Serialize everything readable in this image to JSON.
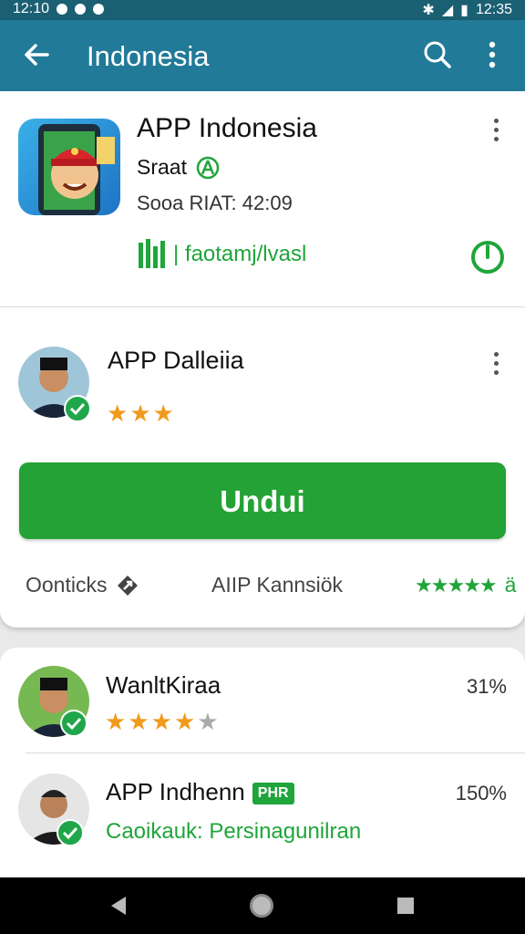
{
  "status_bar": {
    "time_left": "12:10",
    "time_right": "12:35"
  },
  "app_bar": {
    "title": "Indonesia"
  },
  "app": {
    "name": "APP Indonesia",
    "subtitle": "Sraat",
    "meta": "Sooa RIAT: 42:09",
    "link_text": "| faotamj/lvasl"
  },
  "developer": {
    "name": "APP Dalleiia",
    "rating_stars": 3
  },
  "install_button": {
    "label": "Undui"
  },
  "footer": {
    "left_label": "Oonticks",
    "middle_label": "AIIP Kannsiök",
    "right_suffix": "ä"
  },
  "list": [
    {
      "name": "WanltKiraa",
      "percent": "31%",
      "rating_stars": 4
    },
    {
      "name": "APP Indhenn",
      "tag": "PHR",
      "percent": "150%",
      "subtitle": "Caoikauk: Persinagunilran"
    }
  ],
  "colors": {
    "appbar": "#217a97",
    "statusbar": "#1b5f73",
    "accent_green": "#24a235",
    "star_orange": "#f19a1b"
  }
}
